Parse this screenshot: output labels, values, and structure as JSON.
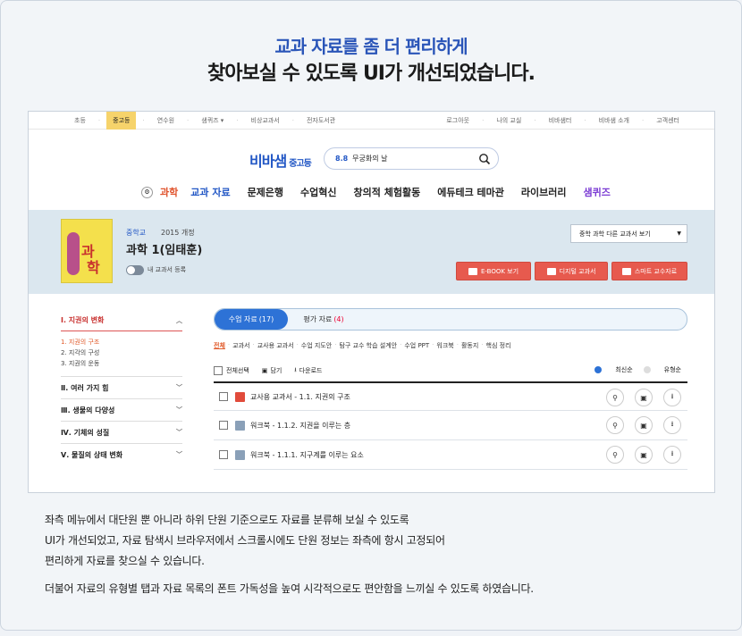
{
  "headline": {
    "line1": "교과 자료를 좀 더 편리하게",
    "line2": "찾아보실 수 있도록 UI가 개선되었습니다."
  },
  "util": {
    "left": [
      "초등",
      "중고등",
      "연수원",
      "샘퀴즈 ▾",
      "비상교과서",
      "전자도서관"
    ],
    "active": "중고등",
    "right": [
      "로그아웃",
      "나의 교실",
      "비바샘터",
      "비바샘 소개",
      "고객센터"
    ]
  },
  "brand": {
    "name": "비바샘",
    "sub": "중고등"
  },
  "search": {
    "tag": "8.8",
    "value": "무궁화의 날"
  },
  "gnb": {
    "subject": "과학",
    "items": [
      "교과 자료",
      "문제은행",
      "수업혁신",
      "창의적 체험활동",
      "에듀테크 테마관",
      "라이브러리",
      "샘퀴즈"
    ]
  },
  "book": {
    "school": "중학교",
    "curriculum": "2015 개정",
    "title": "과학 1(임태훈)",
    "register_label": "내 교과서 등록",
    "cover_t1": "과",
    "cover_t2": "학",
    "other_select": "중학 과학 다른 교과서 보기",
    "btn_ebook": "E-BOOK 보기",
    "btn_digital": "디지털 교과서",
    "btn_smart": "스마트 교수자료"
  },
  "side": {
    "head": "Ⅰ. 지권의 변화",
    "subs": [
      "1. 지권의 구조",
      "2. 지각의 구성",
      "3. 지권의 운동"
    ],
    "items": [
      "Ⅱ. 여러 가지 힘",
      "Ⅲ. 생물의 다양성",
      "Ⅳ. 기체의 성질",
      "Ⅴ. 물질의 상태 변화"
    ]
  },
  "tabs": [
    {
      "label": "수업 자료",
      "count": "(17)"
    },
    {
      "label": "평가 자료",
      "count": "(4)"
    }
  ],
  "filters": [
    "전체",
    "교과서",
    "교사용 교과서",
    "수업 지도안",
    "탐구 교수 학습 설계안",
    "수업 PPT",
    "워크북",
    "활동지",
    "핵심 정리"
  ],
  "tools": {
    "select_all": "전체선택",
    "save": "담기",
    "download": "다운로드",
    "sort_new": "최신순",
    "sort_type": "유형순"
  },
  "rows": [
    {
      "title": "교사용 교과서 - 1.1. 지권의 구조",
      "type": "pdf"
    },
    {
      "title": "워크북 - 1.1.2. 지권을 이루는 층",
      "type": "folder"
    },
    {
      "title": "워크북 - 1.1.1. 지구계를 이루는 요소",
      "type": "folder"
    }
  ],
  "description": {
    "p1": [
      "좌측 메뉴에서 대단원 뿐 아니라 하위 단원 기준으로도 자료를 분류해 보실 수 있도록",
      "UI가 개선되었고, 자료 탐색시 브라우저에서 스크롤시에도 단원 정보는 좌측에 항시 고정되어",
      "편리하게 자료를 찾으실 수 있습니다."
    ],
    "p2": "더불어 자료의 유형별 탭과 자료 목록의 폰트 가독성을 높여 시각적으로도 편안함을 느끼실 수 있도록 하였습니다."
  }
}
